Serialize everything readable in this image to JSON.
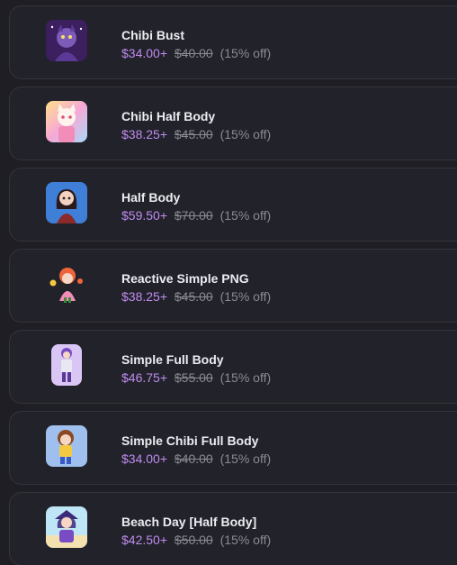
{
  "products": [
    {
      "name": "Chibi Bust",
      "price": "$34.00+",
      "original_price": "$40.00",
      "discount": "(15% off)",
      "thumbnail_icon": "chibi-bust-artwork-icon",
      "thumb_bg": "#3b1f5e"
    },
    {
      "name": "Chibi Half Body",
      "price": "$38.25+",
      "original_price": "$45.00",
      "discount": "(15% off)",
      "thumbnail_icon": "chibi-half-body-artwork-icon",
      "thumb_bg": "#f7d0e6"
    },
    {
      "name": "Half Body",
      "price": "$59.50+",
      "original_price": "$70.00",
      "discount": "(15% off)",
      "thumbnail_icon": "half-body-artwork-icon",
      "thumb_bg": "#3f7fd8"
    },
    {
      "name": "Reactive Simple PNG",
      "price": "$38.25+",
      "original_price": "$45.00",
      "discount": "(15% off)",
      "thumbnail_icon": "reactive-png-artwork-icon",
      "thumb_bg": "#22222a"
    },
    {
      "name": "Simple Full Body",
      "price": "$46.75+",
      "original_price": "$55.00",
      "discount": "(15% off)",
      "thumbnail_icon": "simple-full-body-artwork-icon",
      "thumb_bg": "#d9c6f5"
    },
    {
      "name": "Simple Chibi Full Body",
      "price": "$34.00+",
      "original_price": "$40.00",
      "discount": "(15% off)",
      "thumbnail_icon": "simple-chibi-full-body-artwork-icon",
      "thumb_bg": "#9fc0ee"
    },
    {
      "name": "Beach Day [Half Body]",
      "price": "$42.50+",
      "original_price": "$50.00",
      "discount": "(15% off)",
      "thumbnail_icon": "beach-day-artwork-icon",
      "thumb_bg": "#bfe6f7"
    }
  ]
}
